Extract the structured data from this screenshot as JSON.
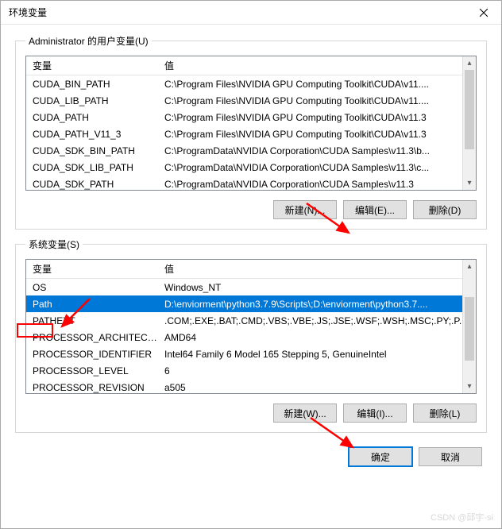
{
  "window": {
    "title": "环境变量"
  },
  "user_section": {
    "legend": "Administrator 的用户变量(U)",
    "headers": {
      "var": "变量",
      "val": "值"
    },
    "rows": [
      {
        "var": "CUDA_BIN_PATH",
        "val": "C:\\Program Files\\NVIDIA GPU Computing Toolkit\\CUDA\\v11...."
      },
      {
        "var": "CUDA_LIB_PATH",
        "val": "C:\\Program Files\\NVIDIA GPU Computing Toolkit\\CUDA\\v11...."
      },
      {
        "var": "CUDA_PATH",
        "val": "C:\\Program Files\\NVIDIA GPU Computing Toolkit\\CUDA\\v11.3"
      },
      {
        "var": "CUDA_PATH_V11_3",
        "val": "C:\\Program Files\\NVIDIA GPU Computing Toolkit\\CUDA\\v11.3"
      },
      {
        "var": "CUDA_SDK_BIN_PATH",
        "val": "C:\\ProgramData\\NVIDIA Corporation\\CUDA Samples\\v11.3\\b..."
      },
      {
        "var": "CUDA_SDK_LIB_PATH",
        "val": "C:\\ProgramData\\NVIDIA Corporation\\CUDA Samples\\v11.3\\c..."
      },
      {
        "var": "CUDA_SDK_PATH",
        "val": "C:\\ProgramData\\NVIDIA Corporation\\CUDA Samples\\v11.3"
      }
    ],
    "buttons": {
      "new": "新建(N)...",
      "edit": "编辑(E)...",
      "del": "删除(D)"
    }
  },
  "sys_section": {
    "legend": "系统变量(S)",
    "headers": {
      "var": "变量",
      "val": "值"
    },
    "rows": [
      {
        "var": "OS",
        "val": "Windows_NT",
        "selected": false
      },
      {
        "var": "Path",
        "val": "D:\\enviorment\\python3.7.9\\Scripts\\;D:\\enviorment\\python3.7....",
        "selected": true
      },
      {
        "var": "PATHEXT",
        "val": ".COM;.EXE;.BAT;.CMD;.VBS;.VBE;.JS;.JSE;.WSF;.WSH;.MSC;.PY;.P..."
      },
      {
        "var": "PROCESSOR_ARCHITECT...",
        "val": "AMD64"
      },
      {
        "var": "PROCESSOR_IDENTIFIER",
        "val": "Intel64 Family 6 Model 165 Stepping 5, GenuineIntel"
      },
      {
        "var": "PROCESSOR_LEVEL",
        "val": "6"
      },
      {
        "var": "PROCESSOR_REVISION",
        "val": "a505"
      }
    ],
    "buttons": {
      "new": "新建(W)...",
      "edit": "编辑(I)...",
      "del": "删除(L)"
    }
  },
  "footer": {
    "ok": "确定",
    "cancel": "取消"
  },
  "watermark": "CSDN @邱宇-si"
}
